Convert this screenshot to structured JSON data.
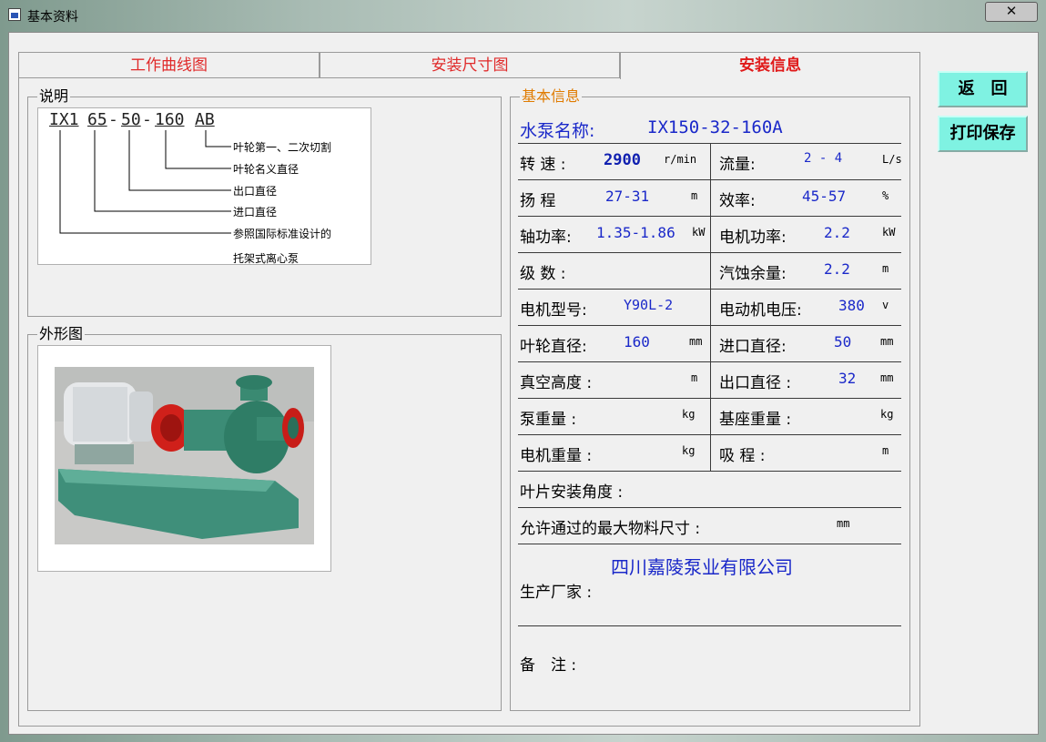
{
  "window": {
    "title": "基本资料",
    "close_label": "✕"
  },
  "tabs": [
    {
      "label": "工作曲线图"
    },
    {
      "label": "安装尺寸图"
    },
    {
      "label": "安装信息"
    }
  ],
  "buttons": {
    "back": "返　回",
    "print_save": "打印保存"
  },
  "explanation": {
    "title": "说明",
    "code_parts": [
      "IX1",
      "65",
      "-",
      "50",
      "-",
      "160",
      "AB"
    ],
    "labels": [
      "叶轮第一、二次切割",
      "叶轮名义直径",
      "出口直径",
      "进口直径",
      "参照国际标准设计的",
      "托架式离心泵"
    ]
  },
  "outline": {
    "title": "外形图"
  },
  "info": {
    "title": "基本信息",
    "pump_name_label": "水泵名称:",
    "pump_name_value": "IX150-32-160A",
    "rows": [
      {
        "l_label": "转 速 :",
        "l_value": "2900",
        "l_unit": "r/min",
        "r_label": "流量:",
        "r_value": "2 - 4",
        "r_unit": "L/s"
      },
      {
        "l_label": "扬 程",
        "l_value": "27-31",
        "l_unit": "m",
        "r_label": "效率:",
        "r_value": "45-57",
        "r_unit": "%"
      },
      {
        "l_label": "轴功率:",
        "l_value": "1.35-1.86",
        "l_unit": "kW",
        "r_label": "电机功率:",
        "r_value": "2.2",
        "r_unit": "kW"
      },
      {
        "l_label": "级 数 :",
        "l_value": "",
        "l_unit": "",
        "r_label": "汽蚀余量:",
        "r_value": "2.2",
        "r_unit": "m"
      },
      {
        "l_label": "电机型号:",
        "l_value": "Y90L-2",
        "l_unit": "",
        "r_label": "电动机电压:",
        "r_value": "380",
        "r_unit": "v"
      },
      {
        "l_label": "叶轮直径:",
        "l_value": "160",
        "l_unit": "mm",
        "r_label": "进口直径:",
        "r_value": "50",
        "r_unit": "mm"
      },
      {
        "l_label": "真空高度 :",
        "l_value": "",
        "l_unit": "m",
        "r_label": "出口直径 :",
        "r_value": "32",
        "r_unit": "mm"
      },
      {
        "l_label": "泵重量 :",
        "l_value": "",
        "l_unit": "kg",
        "r_label": "基座重量 :",
        "r_value": "",
        "r_unit": "kg"
      },
      {
        "l_label": "电机重量 :",
        "l_value": "",
        "l_unit": "kg",
        "r_label": "吸 程 :",
        "r_value": "",
        "r_unit": "m"
      }
    ],
    "blade_angle_label": "叶片安装角度 :",
    "max_material_label": "允许通过的最大物料尺寸 :",
    "max_material_unit": "mm",
    "manufacturer_value": "四川嘉陵泵业有限公司",
    "manufacturer_label": "生产厂家 :",
    "remarks_label": "备　注 :"
  }
}
